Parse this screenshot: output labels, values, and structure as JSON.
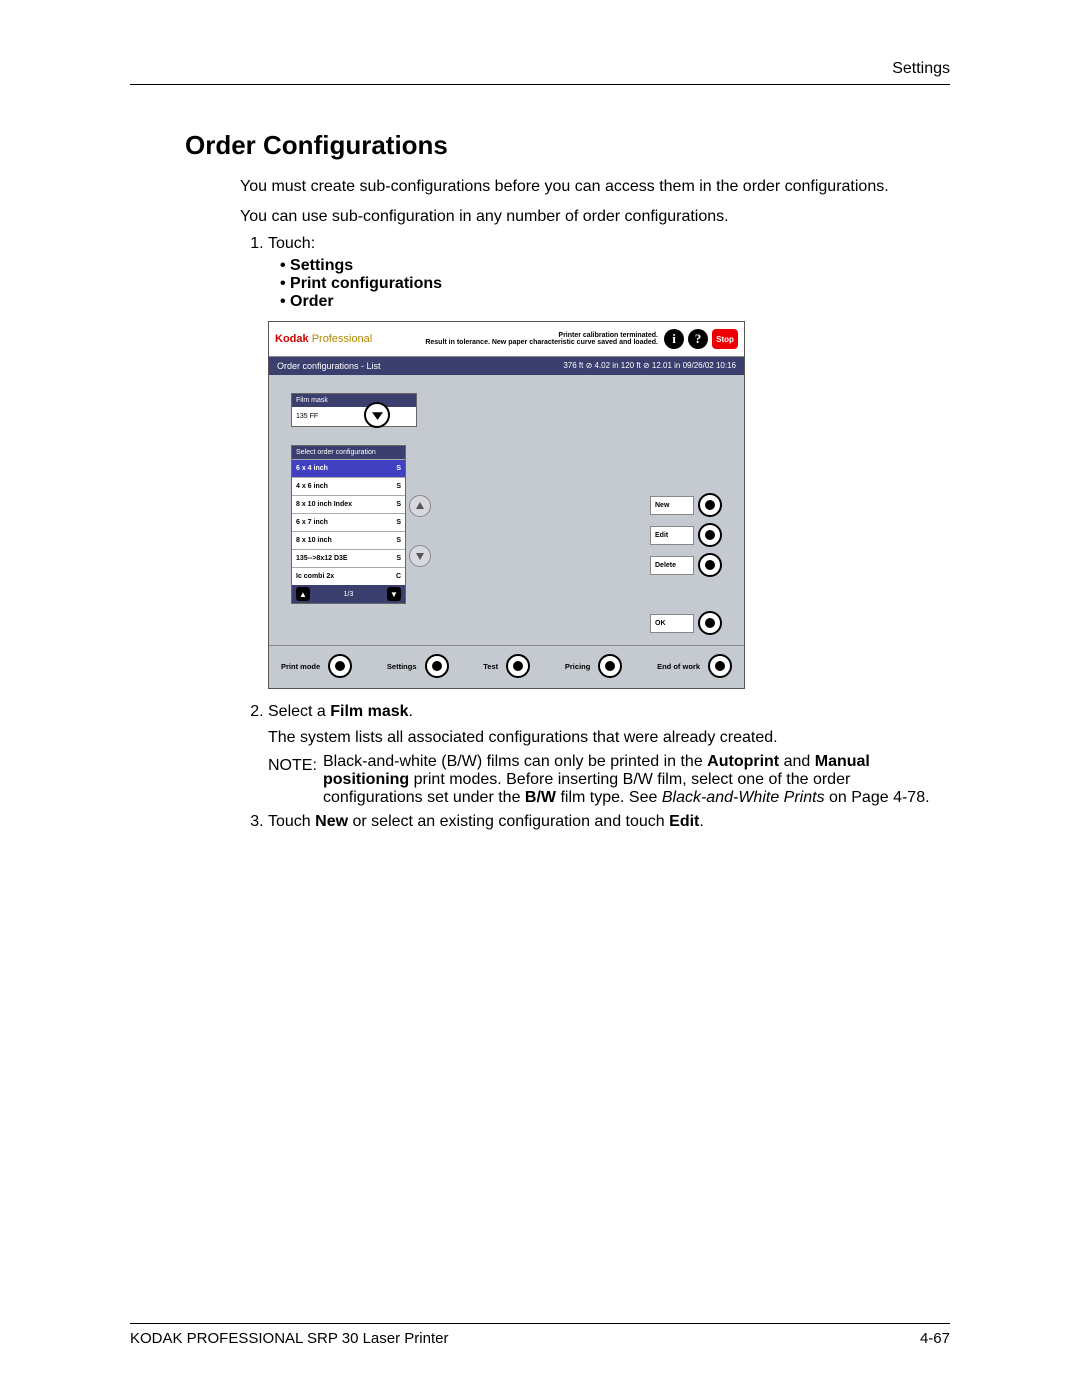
{
  "header": {
    "section": "Settings"
  },
  "title": "Order Configurations",
  "intro1": "You must create sub-configurations before you can access them in the order configurations.",
  "intro2": "You can use sub-configuration in any number of order configurations.",
  "steps": {
    "s1": "Touch:",
    "s1_bullets": [
      "Settings",
      "Print configurations",
      "Order"
    ],
    "s2_prefix": "Select a ",
    "s2_bold": "Film mask",
    "s2_suffix": ".",
    "s2_extra": "The system lists all associated configurations that were already created.",
    "s3_a": "Touch ",
    "s3_b1": "New",
    "s3_c": " or select an existing configuration and touch ",
    "s3_b2": "Edit",
    "s3_d": "."
  },
  "note": {
    "label": "NOTE:",
    "t1": "Black-and-white (B/W) films can only be printed in the ",
    "b1": "Autoprint",
    "t2": " and ",
    "b2": "Manual positioning",
    "t3": " print modes. Before inserting B/W film, select one of the order configurations set under the ",
    "b3": "B/W",
    "t4": " film type. See ",
    "i1": "Black-and-White Prints",
    "t5": " on Page 4-78."
  },
  "ui": {
    "brand1": "Kodak",
    "brand2": "Professional",
    "status_msg": "Printer calibration terminated.\nResult in tolerance. New paper characteristic curve saved and loaded.",
    "stop": "Stop",
    "bar_left": "Order configurations -  List",
    "bar_right": "376 ft ⊘ 4.02 in   120 ft ⊘ 12.01 in  09/26/02      10:16",
    "filmmask_hdr": "Film mask",
    "filmmask_val": "135 FF",
    "list_hdr": "Select order configuration",
    "list": [
      {
        "label": "6 x 4 inch",
        "code": "S",
        "sel": true
      },
      {
        "label": "4 x 6 inch",
        "code": "S",
        "sel": false
      },
      {
        "label": "8 x 10 inch Index",
        "code": "S",
        "sel": false
      },
      {
        "label": "6 x 7 inch",
        "code": "S",
        "sel": false
      },
      {
        "label": "8 x 10 inch",
        "code": "S",
        "sel": false
      },
      {
        "label": "135-->8x12 D3E",
        "code": "S",
        "sel": false
      },
      {
        "label": "Ic combi 2x",
        "code": "C",
        "sel": false
      }
    ],
    "list_page": "1/3",
    "side": {
      "new": "New",
      "edit": "Edit",
      "delete": "Delete",
      "ok": "OK"
    },
    "foot": {
      "print": "Print mode",
      "settings": "Settings",
      "test": "Test",
      "pricing": "Pricing",
      "end": "End of work"
    }
  },
  "footer": {
    "product": "KODAK PROFESSIONAL SRP 30 Laser Printer",
    "page": "4-67"
  }
}
